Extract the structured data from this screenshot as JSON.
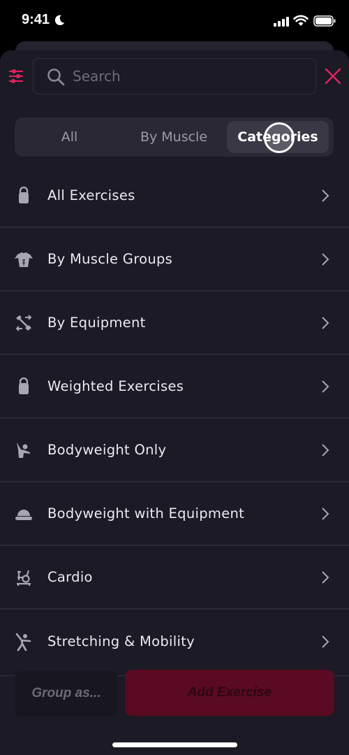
{
  "status_bar": {
    "time": "9:41",
    "focus_icon": "moon-icon",
    "signal_icon": "cellular-signal-icon",
    "wifi_icon": "wifi-icon",
    "battery_icon": "battery-icon"
  },
  "header": {
    "filter_icon": "sliders-icon",
    "search": {
      "value": "",
      "placeholder": "Search"
    },
    "close_icon": "close-icon"
  },
  "tabs": [
    {
      "label": "All",
      "selected": false
    },
    {
      "label": "By Muscle",
      "selected": false
    },
    {
      "label": "Categories",
      "selected": true
    }
  ],
  "categories": [
    {
      "label": "All Exercises",
      "icon": "kettlebell-icon"
    },
    {
      "label": "By Muscle Groups",
      "icon": "torso-icon"
    },
    {
      "label": "By Equipment",
      "icon": "dumbbell-icon"
    },
    {
      "label": "Weighted Exercises",
      "icon": "kettlebell-icon"
    },
    {
      "label": "Bodyweight Only",
      "icon": "bodyweight-person-icon"
    },
    {
      "label": "Bodyweight with Equipment",
      "icon": "balance-ball-icon"
    },
    {
      "label": "Cardio",
      "icon": "exercise-bike-icon"
    },
    {
      "label": "Stretching & Mobility",
      "icon": "stretching-person-icon"
    }
  ],
  "footer": {
    "group_label": "Group as...",
    "add_label": "Add Exercise"
  },
  "colors": {
    "accent": "#e0245e",
    "background": "#1b1a25",
    "add_button": "#5a0a22"
  }
}
